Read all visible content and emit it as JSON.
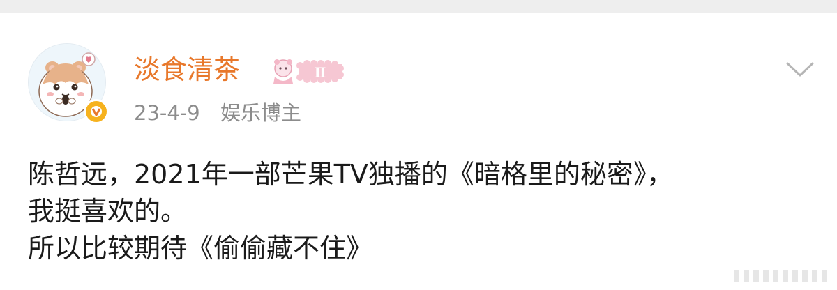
{
  "post": {
    "author": {
      "name": "淡食清茶",
      "avatar": "hamster-avatar",
      "verified_icon": "verified-v-icon",
      "member_badge_text": "Ⅱ"
    },
    "date": "23-4-9",
    "role": "娱乐博主",
    "menu_icon": "chevron-down-icon",
    "lines": [
      "陈哲远，2021年一部芒果TV独播的《暗格里的秘密》，",
      "我挺喜欢的。",
      "所以比较期待《偷偷藏不住》"
    ]
  },
  "colors": {
    "username": "#e8782b",
    "meta": "#8c8c8c",
    "body_text": "#1a1a1a",
    "verified_badge": "#f6b21e",
    "member_badge": "#f4b8c8"
  }
}
